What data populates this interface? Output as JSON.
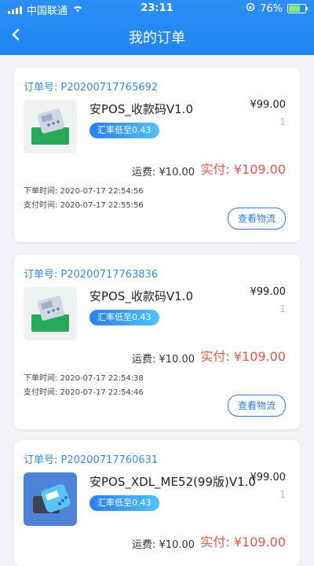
{
  "status_bar": {
    "carrier": "中国联通",
    "time": "23:11",
    "battery": "76%"
  },
  "nav": {
    "title": "我的订单"
  },
  "orders": [
    {
      "order_label": "订单号:",
      "order_no": "P20200717765692",
      "product_name": "安POS_收款码V1.0",
      "price": "¥99.00",
      "qty": "1",
      "badge": "汇率低至0.43",
      "fee_label": "运费:",
      "fee": "¥10.00",
      "paid_label": "实付:",
      "paid": "¥109.00",
      "order_time_label": "下单时间:",
      "order_time": "2020-07-17 22:54:56",
      "pay_time_label": "支付时间:",
      "pay_time": "2020-07-17 22:55:56",
      "logistics_button": "查看物流",
      "thumb_icon": "pos-terminal-green-icon"
    },
    {
      "order_label": "订单号:",
      "order_no": "P20200717763836",
      "product_name": "安POS_收款码V1.0",
      "price": "¥99.00",
      "qty": "1",
      "badge": "汇率低至0.43",
      "fee_label": "运费:",
      "fee": "¥10.00",
      "paid_label": "实付:",
      "paid": "¥109.00",
      "order_time_label": "下单时间:",
      "order_time": "2020-07-17 22:54:38",
      "pay_time_label": "支付时间:",
      "pay_time": "2020-07-17 22:54:46",
      "logistics_button": "查看物流",
      "thumb_icon": "pos-terminal-green-icon"
    },
    {
      "order_label": "订单号:",
      "order_no": "P20200717760631",
      "product_name": "安POS_XDL_ME52(99版)V1.0",
      "price": "¥99.00",
      "qty": "1",
      "badge": "汇率低至0.43",
      "fee_label": "运费:",
      "fee": "¥10.00",
      "paid_label": "实付:",
      "paid": "¥109.00",
      "thumb_icon": "pos-terminal-blue-icon"
    }
  ]
}
